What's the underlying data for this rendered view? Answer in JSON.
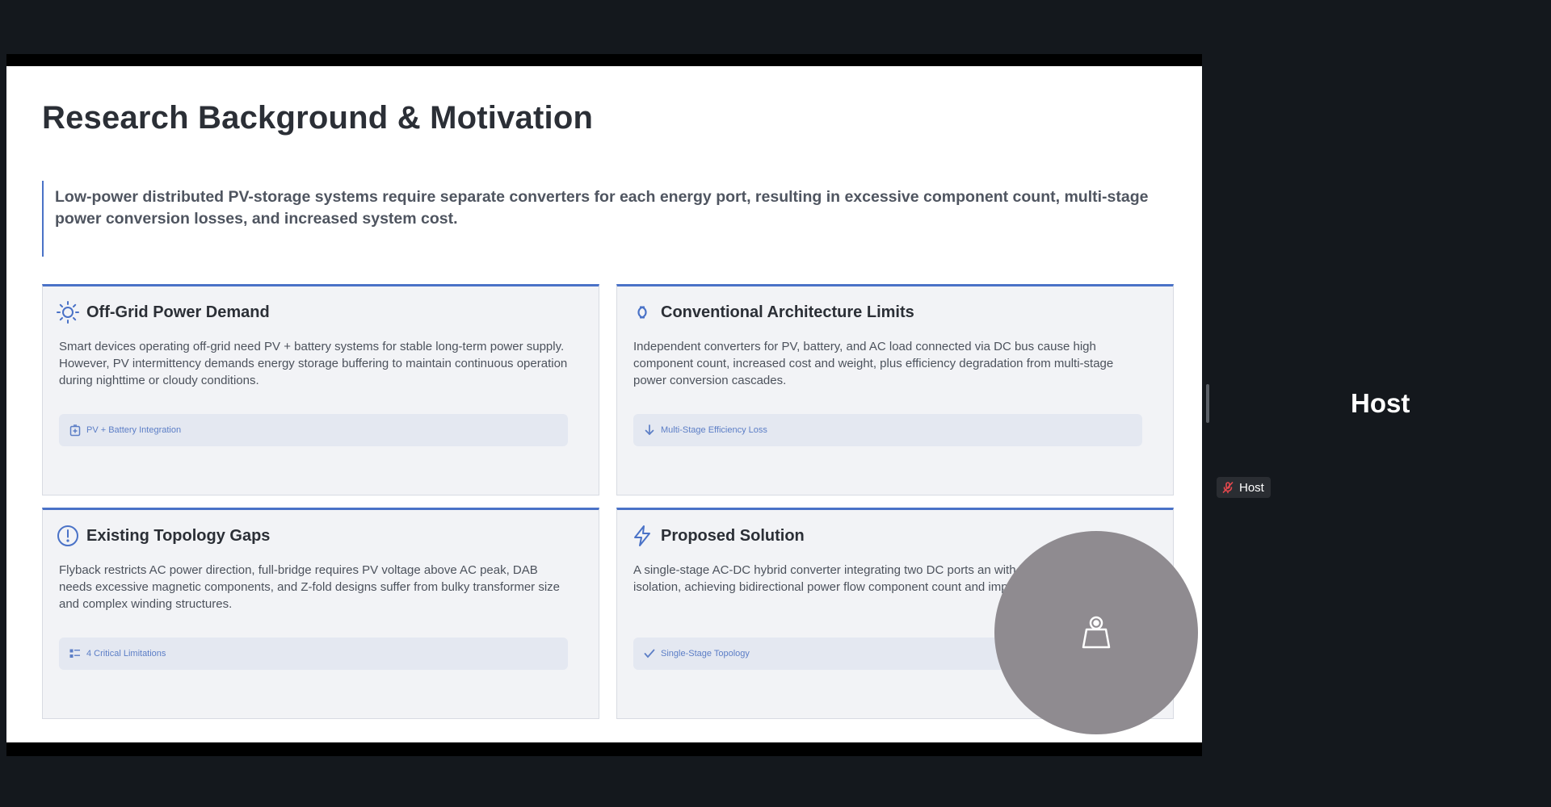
{
  "slide": {
    "title": "Research Background & Motivation",
    "intro": "Low-power distributed PV-storage systems require separate converters for each energy port, resulting in excessive component count, multi-stage power conversion losses, and increased system cost.",
    "cards": [
      {
        "icon": "sun-icon",
        "title": "Off-Grid Power Demand",
        "text": "Smart devices operating off-grid need PV + battery systems for stable long-term power supply. However, PV intermittency demands energy storage buffering to maintain continuous operation during nighttime or cloudy conditions.",
        "tag_icon": "battery-icon",
        "tag": "PV + Battery Integration"
      },
      {
        "icon": "link-icon",
        "title": "Conventional Architecture Limits",
        "text": "Independent converters for PV, battery, and AC load connected via DC bus cause high component count, increased cost and weight, plus efficiency degradation from multi-stage power conversion cascades.",
        "tag_icon": "arrow-down-icon",
        "tag": "Multi-Stage Efficiency Loss"
      },
      {
        "icon": "alert-circle-icon",
        "title": "Existing Topology Gaps",
        "text": "Flyback restricts AC power direction, full-bridge requires PV voltage above AC peak, DAB needs excessive magnetic components, and Z-fold designs suffer from bulky transformer size and complex winding structures.",
        "tag_icon": "list-icon",
        "tag": "4 Critical Limitations"
      },
      {
        "icon": "lightning-icon",
        "title": "Proposed Solution",
        "text": "A single-stage AC-DC hybrid converter integrating two DC ports an with high-frequency isolation, achieving bidirectional power flow component count and improved power density.",
        "tag_icon": "check-icon",
        "tag": "Single-Stage Topology"
      }
    ]
  },
  "participant": {
    "name_large": "Host",
    "chip_label": "Host",
    "mic_icon": "mic-muted-icon",
    "camera_icon": "camera-off-icon"
  },
  "colors": {
    "accent": "#4a72c7",
    "background": "#14181d",
    "card_bg": "#f2f3f6",
    "muted_red": "#e5484d"
  }
}
